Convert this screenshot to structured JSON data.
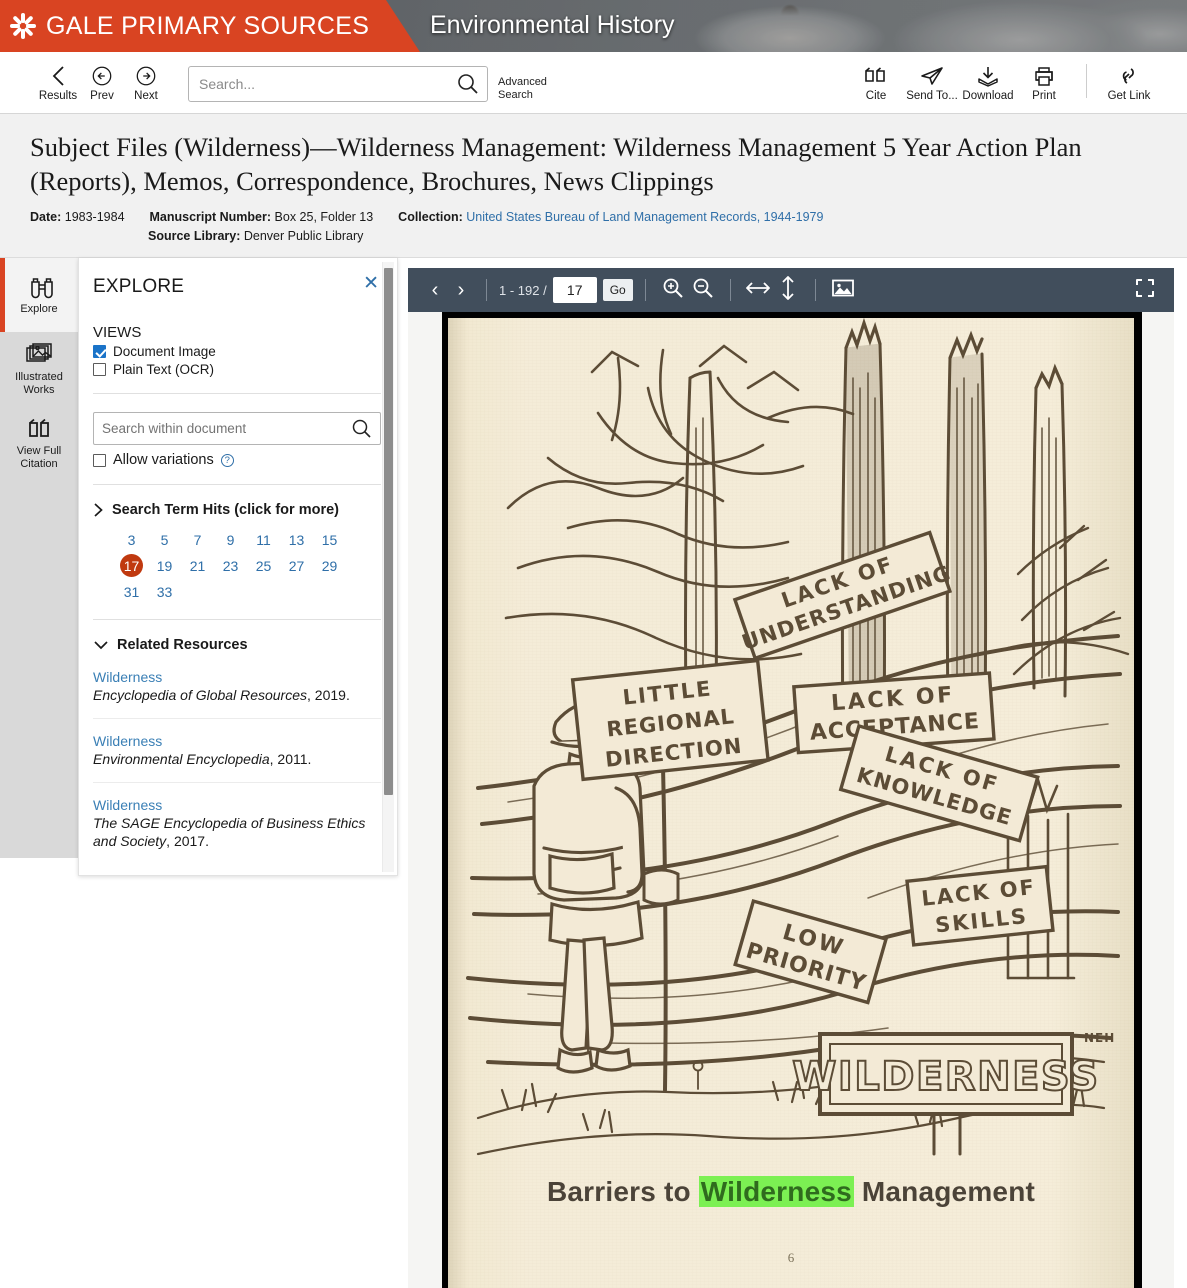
{
  "brand": {
    "logo_icon": "gale-starburst-icon",
    "name": "GALE PRIMARY SOURCES",
    "product": "Environmental History",
    "accent_color": "#d94422",
    "banner_color": "#2c3a47"
  },
  "toolbar": {
    "results_label": "Results",
    "prev_label": "Prev",
    "next_label": "Next",
    "search_placeholder": "Search...",
    "search_value": "",
    "advanced_search_line1": "Advanced",
    "advanced_search_line2": "Search",
    "actions": [
      {
        "label": "Cite",
        "icon": "quote-icon"
      },
      {
        "label": "Send To...",
        "icon": "paper-plane-icon"
      },
      {
        "label": "Download",
        "icon": "download-icon"
      },
      {
        "label": "Print",
        "icon": "printer-icon"
      },
      {
        "label": "Get Link",
        "icon": "link-icon"
      }
    ]
  },
  "document_header": {
    "title": "Subject Files (Wilderness)—Wilderness Management: Wilderness Management 5 Year Action Plan (Reports), Memos, Correspondence, Brochures, News Clippings",
    "date_key": "Date:",
    "date_value": "1983-1984",
    "manuscript_key": "Manuscript Number:",
    "manuscript_value": "Box 25, Folder 13",
    "collection_key": "Collection:",
    "collection_value": "United States Bureau of Land Management Records, 1944-1979",
    "source_library_key": "Source Library:",
    "source_library_value": "Denver Public Library"
  },
  "rail": [
    {
      "label": "Explore",
      "icon": "binoculars-icon",
      "active": true
    },
    {
      "label_line1": "Illustrated",
      "label_line2": "Works",
      "icon": "images-icon",
      "active": false
    },
    {
      "label_line1": "View Full",
      "label_line2": "Citation",
      "icon": "quote-icon",
      "active": false
    }
  ],
  "explore_panel": {
    "title": "EXPLORE",
    "close_icon": "close-icon",
    "views_label": "VIEWS",
    "views": [
      {
        "label": "Document Image",
        "checked": true
      },
      {
        "label": "Plain Text (OCR)",
        "checked": false
      }
    ],
    "doc_search_placeholder": "Search within document",
    "doc_search_value": "",
    "allow_variations_label": "Allow variations",
    "allow_variations_checked": false,
    "help_icon": "question-mark-icon",
    "search_hits_label": "Search Term Hits (click for more)",
    "search_hits": [
      "3",
      "5",
      "7",
      "9",
      "11",
      "13",
      "15",
      "17",
      "19",
      "21",
      "23",
      "25",
      "27",
      "29",
      "31",
      "33"
    ],
    "current_hit": "17",
    "current_hit_color": "#c0390f",
    "related_resources_label": "Related Resources",
    "related_resources": [
      {
        "link": "Wilderness",
        "source": "Encyclopedia of Global Resources",
        "year": ", 2019."
      },
      {
        "link": "Wilderness",
        "source": "Environmental Encyclopedia",
        "year": ", 2011."
      },
      {
        "link": "Wilderness",
        "source": "The SAGE Encyclopedia of Business Ethics and Society",
        "year": ", 2017."
      }
    ]
  },
  "viewer": {
    "prev_icon": "chevron-left-icon",
    "next_icon": "chevron-right-icon",
    "page_range": "1 - 192 /",
    "page_value": "17",
    "go_label": "Go",
    "zoom_in_icon": "zoom-in-icon",
    "zoom_out_icon": "zoom-out-icon",
    "fit_width_icon": "fit-width-icon",
    "fit_height_icon": "fit-height-icon",
    "image_icon": "image-icon",
    "fullscreen_icon": "fullscreen-icon"
  },
  "document_page": {
    "illustration_title": "Barriers to Wilderness Management",
    "caption_part1": "Barriers to ",
    "caption_highlight": "Wilderness",
    "caption_part3": " Management",
    "highlight_color": "#7cf053",
    "folio": "6",
    "signs": [
      "LACK OF UNDERSTANDING",
      "LACK OF ACCEPTANCE",
      "LITTLE REGIONAL DIRECTION",
      "LACK OF KNOWLEDGE",
      "LACK OF SKILLS",
      "LOW PRIORITY",
      "WILDERNESS"
    ],
    "artist_mark": "NEH"
  }
}
